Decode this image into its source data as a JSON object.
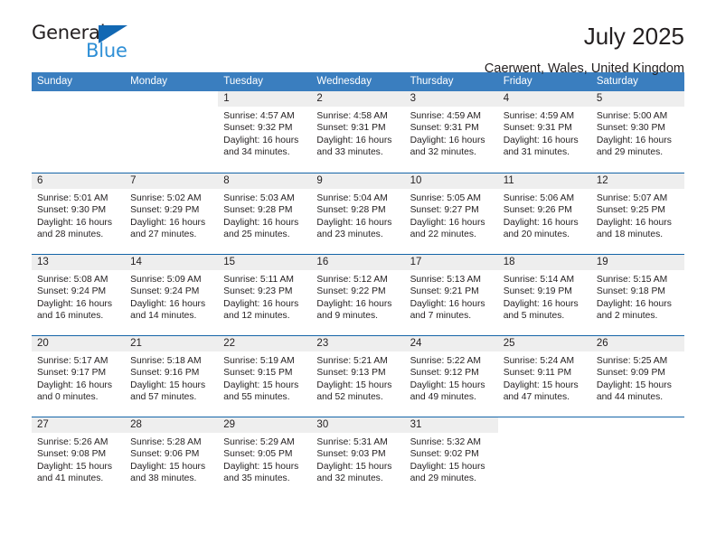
{
  "brand": {
    "name_top": "General",
    "name_bottom": "Blue",
    "triangle_color": "#1268b3",
    "blue_text_color": "#2e8fd6"
  },
  "header": {
    "title": "July 2025",
    "subtitle": "Caerwent, Wales, United Kingdom"
  },
  "theme": {
    "header_band": "#3a7ebf",
    "row_divider": "#1565a8",
    "daynum_strip": "#eeeeee"
  },
  "weekdays": [
    "Sunday",
    "Monday",
    "Tuesday",
    "Wednesday",
    "Thursday",
    "Friday",
    "Saturday"
  ],
  "labels": {
    "sunrise_prefix": "Sunrise:",
    "sunset_prefix": "Sunset:",
    "daylight_prefix": "Daylight:"
  },
  "weeks": [
    [
      {
        "day": "",
        "sunrise": "",
        "sunset": "",
        "daylight_line1": "",
        "daylight_line2": ""
      },
      {
        "day": "",
        "sunrise": "",
        "sunset": "",
        "daylight_line1": "",
        "daylight_line2": ""
      },
      {
        "day": "1",
        "sunrise": "Sunrise: 4:57 AM",
        "sunset": "Sunset: 9:32 PM",
        "daylight_line1": "Daylight: 16 hours",
        "daylight_line2": "and 34 minutes."
      },
      {
        "day": "2",
        "sunrise": "Sunrise: 4:58 AM",
        "sunset": "Sunset: 9:31 PM",
        "daylight_line1": "Daylight: 16 hours",
        "daylight_line2": "and 33 minutes."
      },
      {
        "day": "3",
        "sunrise": "Sunrise: 4:59 AM",
        "sunset": "Sunset: 9:31 PM",
        "daylight_line1": "Daylight: 16 hours",
        "daylight_line2": "and 32 minutes."
      },
      {
        "day": "4",
        "sunrise": "Sunrise: 4:59 AM",
        "sunset": "Sunset: 9:31 PM",
        "daylight_line1": "Daylight: 16 hours",
        "daylight_line2": "and 31 minutes."
      },
      {
        "day": "5",
        "sunrise": "Sunrise: 5:00 AM",
        "sunset": "Sunset: 9:30 PM",
        "daylight_line1": "Daylight: 16 hours",
        "daylight_line2": "and 29 minutes."
      }
    ],
    [
      {
        "day": "6",
        "sunrise": "Sunrise: 5:01 AM",
        "sunset": "Sunset: 9:30 PM",
        "daylight_line1": "Daylight: 16 hours",
        "daylight_line2": "and 28 minutes."
      },
      {
        "day": "7",
        "sunrise": "Sunrise: 5:02 AM",
        "sunset": "Sunset: 9:29 PM",
        "daylight_line1": "Daylight: 16 hours",
        "daylight_line2": "and 27 minutes."
      },
      {
        "day": "8",
        "sunrise": "Sunrise: 5:03 AM",
        "sunset": "Sunset: 9:28 PM",
        "daylight_line1": "Daylight: 16 hours",
        "daylight_line2": "and 25 minutes."
      },
      {
        "day": "9",
        "sunrise": "Sunrise: 5:04 AM",
        "sunset": "Sunset: 9:28 PM",
        "daylight_line1": "Daylight: 16 hours",
        "daylight_line2": "and 23 minutes."
      },
      {
        "day": "10",
        "sunrise": "Sunrise: 5:05 AM",
        "sunset": "Sunset: 9:27 PM",
        "daylight_line1": "Daylight: 16 hours",
        "daylight_line2": "and 22 minutes."
      },
      {
        "day": "11",
        "sunrise": "Sunrise: 5:06 AM",
        "sunset": "Sunset: 9:26 PM",
        "daylight_line1": "Daylight: 16 hours",
        "daylight_line2": "and 20 minutes."
      },
      {
        "day": "12",
        "sunrise": "Sunrise: 5:07 AM",
        "sunset": "Sunset: 9:25 PM",
        "daylight_line1": "Daylight: 16 hours",
        "daylight_line2": "and 18 minutes."
      }
    ],
    [
      {
        "day": "13",
        "sunrise": "Sunrise: 5:08 AM",
        "sunset": "Sunset: 9:24 PM",
        "daylight_line1": "Daylight: 16 hours",
        "daylight_line2": "and 16 minutes."
      },
      {
        "day": "14",
        "sunrise": "Sunrise: 5:09 AM",
        "sunset": "Sunset: 9:24 PM",
        "daylight_line1": "Daylight: 16 hours",
        "daylight_line2": "and 14 minutes."
      },
      {
        "day": "15",
        "sunrise": "Sunrise: 5:11 AM",
        "sunset": "Sunset: 9:23 PM",
        "daylight_line1": "Daylight: 16 hours",
        "daylight_line2": "and 12 minutes."
      },
      {
        "day": "16",
        "sunrise": "Sunrise: 5:12 AM",
        "sunset": "Sunset: 9:22 PM",
        "daylight_line1": "Daylight: 16 hours",
        "daylight_line2": "and 9 minutes."
      },
      {
        "day": "17",
        "sunrise": "Sunrise: 5:13 AM",
        "sunset": "Sunset: 9:21 PM",
        "daylight_line1": "Daylight: 16 hours",
        "daylight_line2": "and 7 minutes."
      },
      {
        "day": "18",
        "sunrise": "Sunrise: 5:14 AM",
        "sunset": "Sunset: 9:19 PM",
        "daylight_line1": "Daylight: 16 hours",
        "daylight_line2": "and 5 minutes."
      },
      {
        "day": "19",
        "sunrise": "Sunrise: 5:15 AM",
        "sunset": "Sunset: 9:18 PM",
        "daylight_line1": "Daylight: 16 hours",
        "daylight_line2": "and 2 minutes."
      }
    ],
    [
      {
        "day": "20",
        "sunrise": "Sunrise: 5:17 AM",
        "sunset": "Sunset: 9:17 PM",
        "daylight_line1": "Daylight: 16 hours",
        "daylight_line2": "and 0 minutes."
      },
      {
        "day": "21",
        "sunrise": "Sunrise: 5:18 AM",
        "sunset": "Sunset: 9:16 PM",
        "daylight_line1": "Daylight: 15 hours",
        "daylight_line2": "and 57 minutes."
      },
      {
        "day": "22",
        "sunrise": "Sunrise: 5:19 AM",
        "sunset": "Sunset: 9:15 PM",
        "daylight_line1": "Daylight: 15 hours",
        "daylight_line2": "and 55 minutes."
      },
      {
        "day": "23",
        "sunrise": "Sunrise: 5:21 AM",
        "sunset": "Sunset: 9:13 PM",
        "daylight_line1": "Daylight: 15 hours",
        "daylight_line2": "and 52 minutes."
      },
      {
        "day": "24",
        "sunrise": "Sunrise: 5:22 AM",
        "sunset": "Sunset: 9:12 PM",
        "daylight_line1": "Daylight: 15 hours",
        "daylight_line2": "and 49 minutes."
      },
      {
        "day": "25",
        "sunrise": "Sunrise: 5:24 AM",
        "sunset": "Sunset: 9:11 PM",
        "daylight_line1": "Daylight: 15 hours",
        "daylight_line2": "and 47 minutes."
      },
      {
        "day": "26",
        "sunrise": "Sunrise: 5:25 AM",
        "sunset": "Sunset: 9:09 PM",
        "daylight_line1": "Daylight: 15 hours",
        "daylight_line2": "and 44 minutes."
      }
    ],
    [
      {
        "day": "27",
        "sunrise": "Sunrise: 5:26 AM",
        "sunset": "Sunset: 9:08 PM",
        "daylight_line1": "Daylight: 15 hours",
        "daylight_line2": "and 41 minutes."
      },
      {
        "day": "28",
        "sunrise": "Sunrise: 5:28 AM",
        "sunset": "Sunset: 9:06 PM",
        "daylight_line1": "Daylight: 15 hours",
        "daylight_line2": "and 38 minutes."
      },
      {
        "day": "29",
        "sunrise": "Sunrise: 5:29 AM",
        "sunset": "Sunset: 9:05 PM",
        "daylight_line1": "Daylight: 15 hours",
        "daylight_line2": "and 35 minutes."
      },
      {
        "day": "30",
        "sunrise": "Sunrise: 5:31 AM",
        "sunset": "Sunset: 9:03 PM",
        "daylight_line1": "Daylight: 15 hours",
        "daylight_line2": "and 32 minutes."
      },
      {
        "day": "31",
        "sunrise": "Sunrise: 5:32 AM",
        "sunset": "Sunset: 9:02 PM",
        "daylight_line1": "Daylight: 15 hours",
        "daylight_line2": "and 29 minutes."
      },
      {
        "day": "",
        "sunrise": "",
        "sunset": "",
        "daylight_line1": "",
        "daylight_line2": ""
      },
      {
        "day": "",
        "sunrise": "",
        "sunset": "",
        "daylight_line1": "",
        "daylight_line2": ""
      }
    ]
  ]
}
